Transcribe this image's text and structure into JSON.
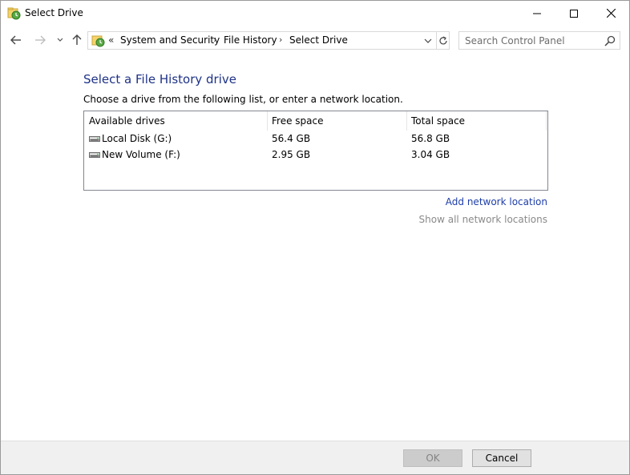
{
  "window": {
    "title": "Select Drive",
    "icon": "file-history-icon"
  },
  "nav": {
    "back_icon": "arrow-left-icon",
    "forward_icon": "arrow-right-icon",
    "recent_icon": "chevron-down-icon",
    "up_icon": "arrow-up-icon"
  },
  "address": {
    "overflow": "«",
    "crumbs": [
      "System and Security",
      "File History",
      "Select Drive"
    ],
    "separator": "›"
  },
  "search": {
    "placeholder": "Search Control Panel",
    "value": ""
  },
  "content": {
    "heading": "Select a File History drive",
    "instruction": "Choose a drive from the following list, or enter a network location."
  },
  "drives": {
    "columns": [
      "Available drives",
      "Free space",
      "Total space"
    ],
    "rows": [
      {
        "name": "Local Disk (G:)",
        "free": "56.4 GB",
        "total": "56.8 GB",
        "icon": "drive-icon"
      },
      {
        "name": "New Volume (F:)",
        "free": "2.95 GB",
        "total": "3.04 GB",
        "icon": "drive-icon"
      }
    ]
  },
  "links": {
    "add_network": "Add network location",
    "show_all_network": "Show all network locations"
  },
  "buttons": {
    "ok": "OK",
    "cancel": "Cancel"
  },
  "colors": {
    "heading": "#1e3287",
    "link": "#1e3ea8",
    "disabled_link": "#8a8a8a"
  }
}
